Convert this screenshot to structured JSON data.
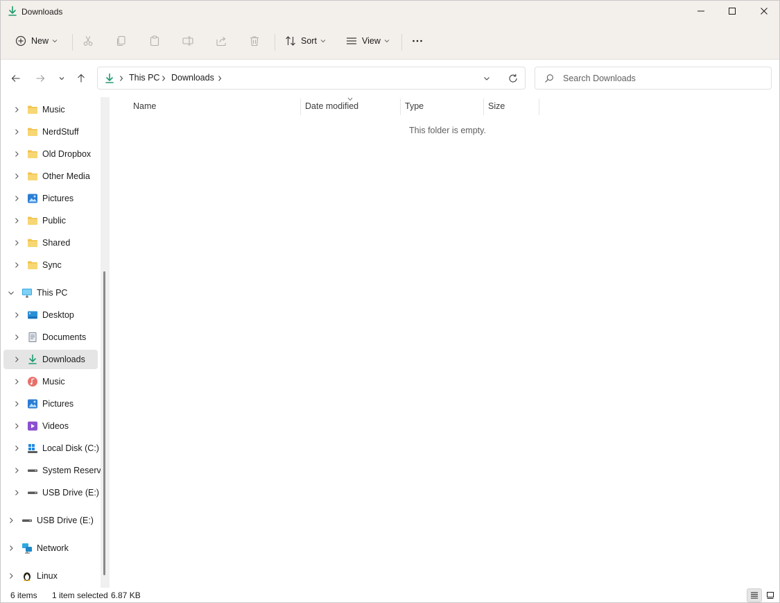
{
  "window": {
    "title": "Downloads",
    "minimize_icon": "minimize-icon",
    "maximize_icon": "maximize-icon",
    "close_icon": "close-icon"
  },
  "commandbar": {
    "new_label": "New",
    "sort_label": "Sort",
    "view_label": "View",
    "icons": [
      "add-circle-icon",
      "cut-icon",
      "copy-icon",
      "paste-icon",
      "rename-icon",
      "share-icon",
      "delete-icon",
      "sort-icon",
      "view-icon",
      "more-icon"
    ]
  },
  "address": {
    "crumbs": [
      "This PC",
      "Downloads"
    ]
  },
  "search": {
    "placeholder": "Search Downloads"
  },
  "sidebar": {
    "items": [
      {
        "label": "Music"
      },
      {
        "label": "NerdStuff"
      },
      {
        "label": "Old Dropbox"
      },
      {
        "label": "Other Media"
      },
      {
        "label": "Pictures"
      },
      {
        "label": "Public"
      },
      {
        "label": "Shared"
      },
      {
        "label": "Sync"
      },
      {
        "label": "This PC"
      },
      {
        "label": "Desktop"
      },
      {
        "label": "Documents"
      },
      {
        "label": "Downloads"
      },
      {
        "label": "Music"
      },
      {
        "label": "Pictures"
      },
      {
        "label": "Videos"
      },
      {
        "label": "Local Disk (C:)"
      },
      {
        "label": "System Reserved"
      },
      {
        "label": "USB Drive (E:)"
      },
      {
        "label": "USB Drive (E:)"
      },
      {
        "label": "Network"
      },
      {
        "label": "Linux"
      }
    ]
  },
  "columns": {
    "name": "Name",
    "date_modified": "Date modified",
    "type": "Type",
    "size": "Size"
  },
  "content": {
    "empty_message": "This folder is empty."
  },
  "status": {
    "items_count": "6 items",
    "selection": "1 item selected",
    "selection_size": "6.87 KB"
  },
  "colors": {
    "titlebar_bg": "#f3efea",
    "accent_green": "#1e9b6e",
    "folder_yellow": "#f2c14e",
    "selected_bg": "#e5e5e5"
  }
}
